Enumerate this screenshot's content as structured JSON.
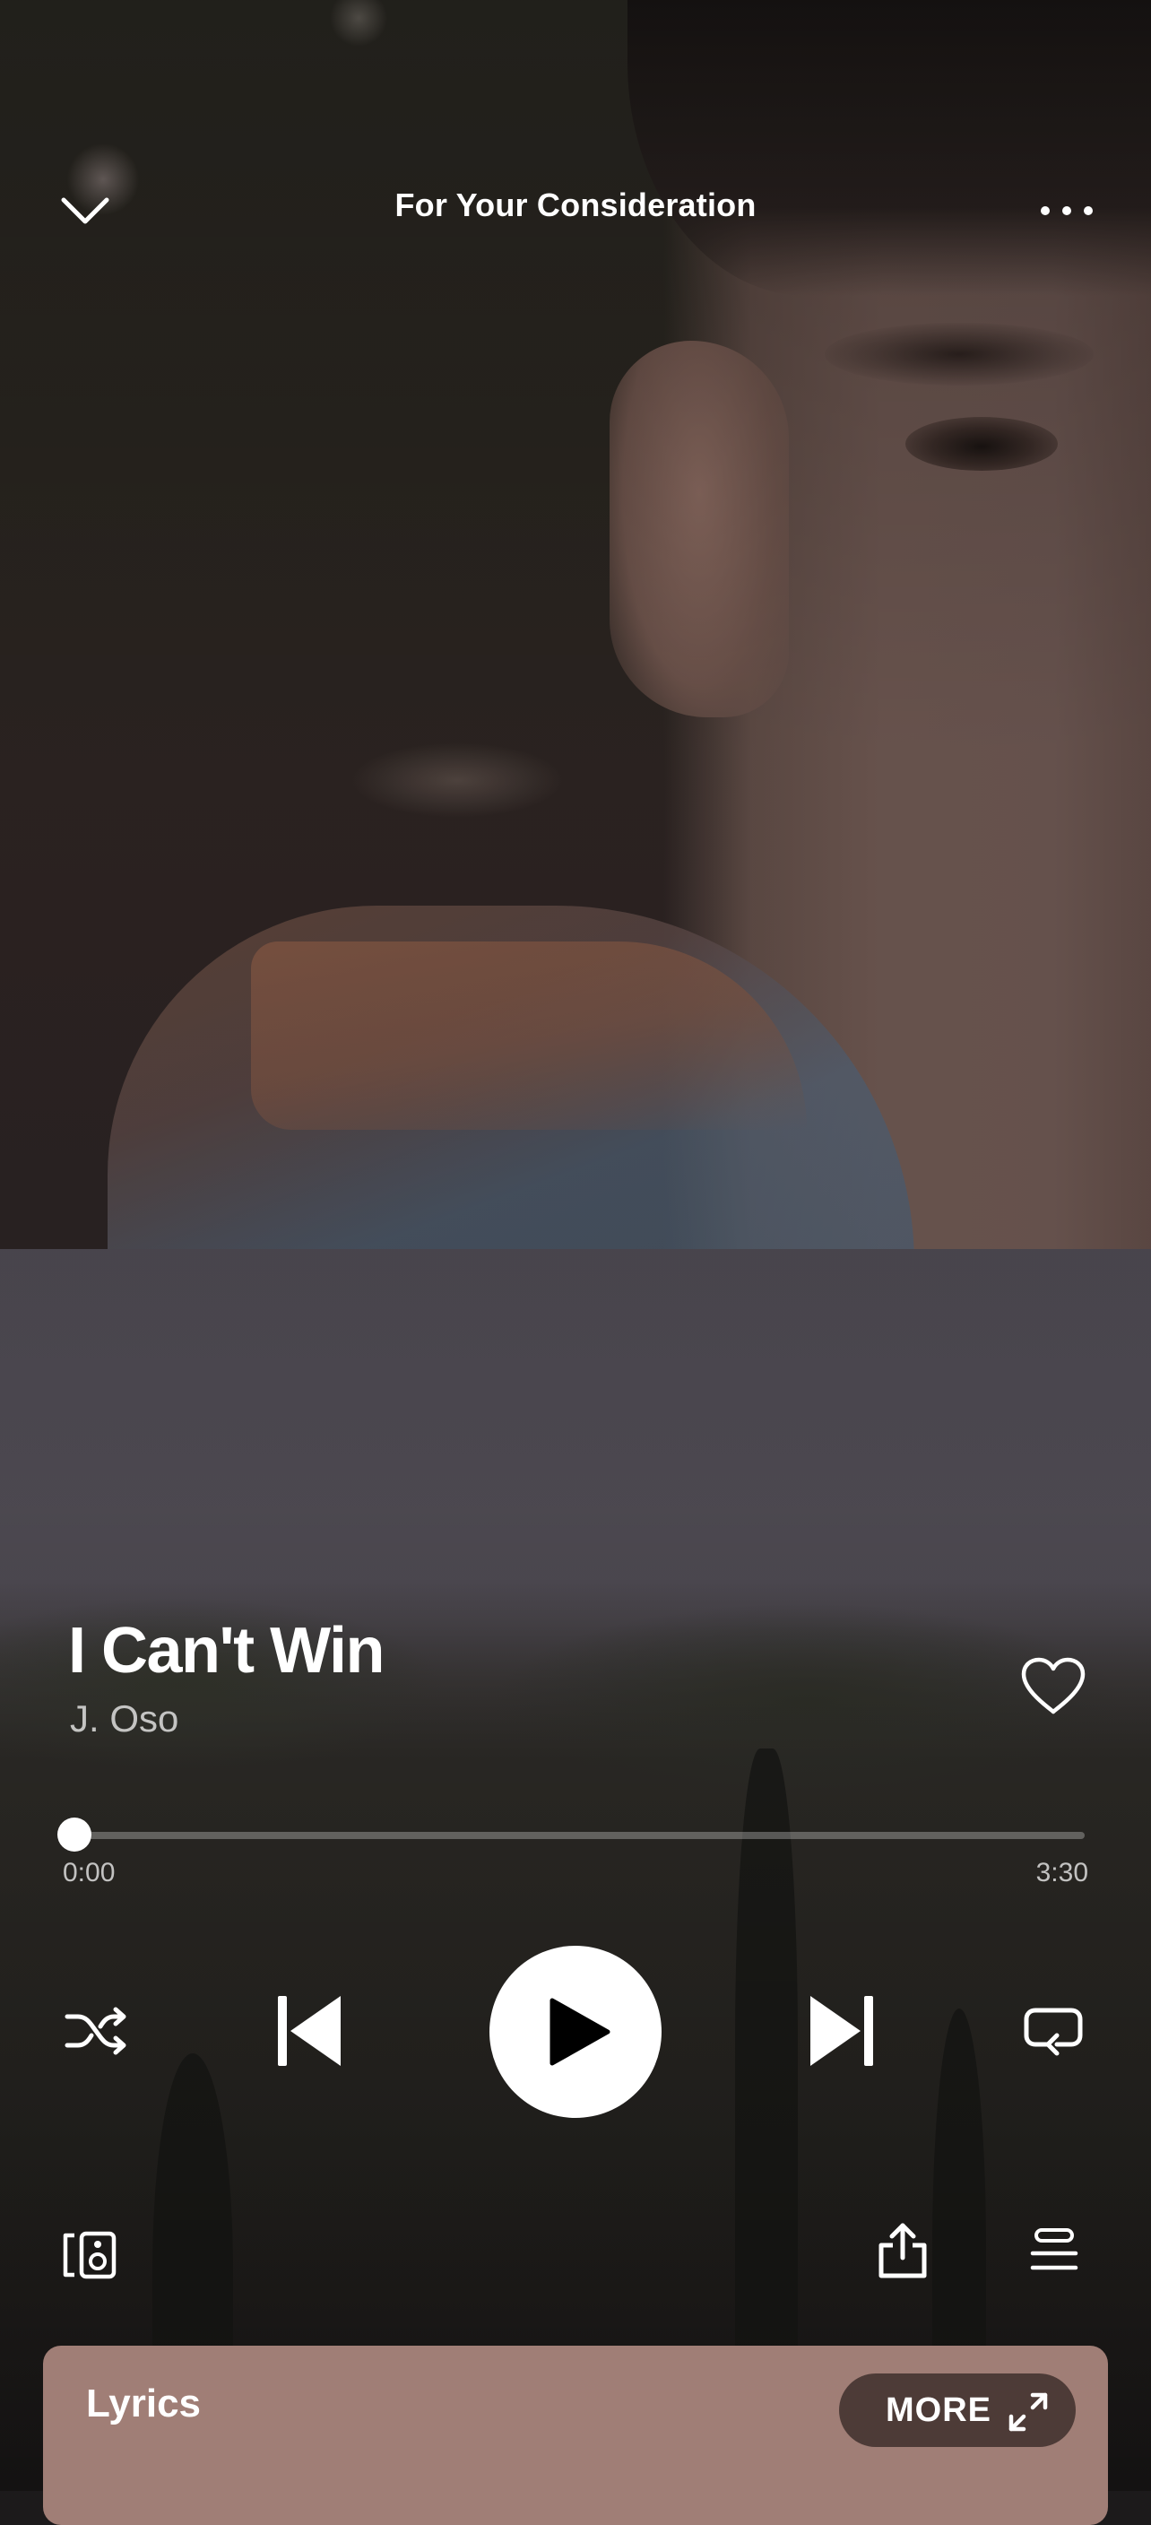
{
  "header": {
    "context_title": "For Your Consideration"
  },
  "track": {
    "title": "I Can't Win",
    "artist": "J. Oso",
    "liked": false
  },
  "playback": {
    "elapsed": "0:00",
    "duration": "3:30",
    "progress_fraction": 0.0,
    "state": "paused",
    "shuffle": false,
    "repeat": false
  },
  "lyrics": {
    "label": "Lyrics",
    "more_label": "MORE"
  },
  "icons": {
    "collapse": "chevron-down-icon",
    "more": "more-horizontal-icon",
    "like": "heart-outline-icon",
    "shuffle": "shuffle-icon",
    "previous": "skip-previous-icon",
    "play": "play-icon",
    "next": "skip-next-icon",
    "repeat": "repeat-icon",
    "devices": "connect-device-icon",
    "share": "share-icon",
    "queue": "queue-icon",
    "expand": "expand-icon"
  },
  "colors": {
    "lyrics_card": "#a07e76",
    "more_pill": "#4d3b37",
    "text_primary": "#ffffff"
  }
}
